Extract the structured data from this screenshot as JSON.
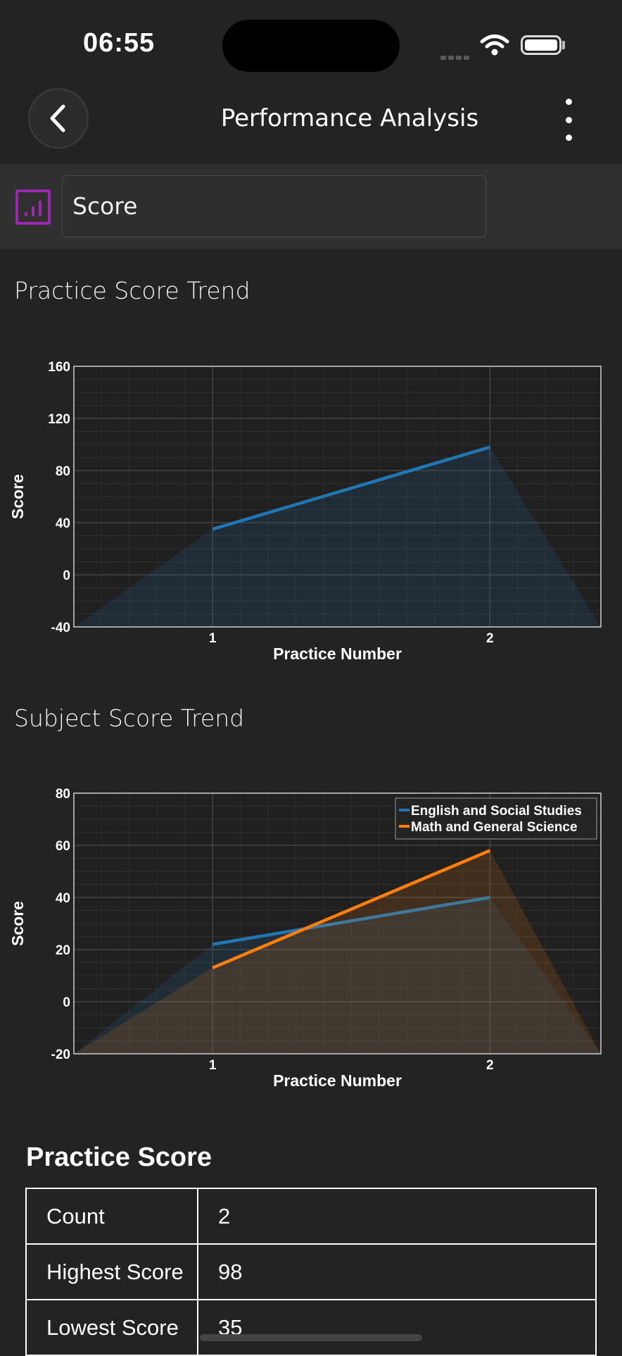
{
  "status_bar": {
    "time": "06:55"
  },
  "header": {
    "title": "Performance Analysis"
  },
  "selector": {
    "value": "Score"
  },
  "sections": {
    "practice_trend_title": "Practice Score Trend",
    "subject_trend_title": "Subject Score Trend"
  },
  "colors": {
    "blue": "#1f77b4",
    "orange": "#ff7f0e",
    "accent": "#9c27b0"
  },
  "chart_data": [
    {
      "type": "area",
      "xlabel": "Practice Number",
      "ylabel": "Score",
      "xticks": [
        1,
        2
      ],
      "yticks": [
        -40,
        0,
        40,
        80,
        120,
        160
      ],
      "ylim": [
        -40,
        160
      ],
      "xlim": [
        0.5,
        2.4
      ],
      "grid": true,
      "series": [
        {
          "values": [
            {
              "x": 0.5,
              "y": -40
            },
            {
              "x": 1,
              "y": 35
            },
            {
              "x": 2,
              "y": 98
            },
            {
              "x": 2.4,
              "y": -40
            }
          ],
          "color": "#1f77b4"
        }
      ]
    },
    {
      "type": "area",
      "xlabel": "Practice Number",
      "ylabel": "Score",
      "xticks": [
        1,
        2
      ],
      "yticks": [
        -20,
        0,
        20,
        40,
        60,
        80
      ],
      "ylim": [
        -20,
        80
      ],
      "xlim": [
        0.5,
        2.4
      ],
      "grid": true,
      "legend_position": "top-right",
      "series": [
        {
          "name": "English and Social Studies",
          "values": [
            {
              "x": 0.5,
              "y": -20
            },
            {
              "x": 1,
              "y": 22
            },
            {
              "x": 2,
              "y": 40
            },
            {
              "x": 2.4,
              "y": -20
            }
          ],
          "color": "#1f77b4"
        },
        {
          "name": "Math and General Science",
          "values": [
            {
              "x": 0.5,
              "y": -20
            },
            {
              "x": 1,
              "y": 13
            },
            {
              "x": 2,
              "y": 58
            },
            {
              "x": 2.4,
              "y": -20
            }
          ],
          "color": "#ff7f0e"
        }
      ]
    }
  ],
  "practice_score": {
    "title": "Practice Score",
    "rows": [
      {
        "label": "Count",
        "value": "2"
      },
      {
        "label": "Highest Score",
        "value": "98"
      },
      {
        "label": "Lowest Score",
        "value": "35"
      }
    ]
  }
}
